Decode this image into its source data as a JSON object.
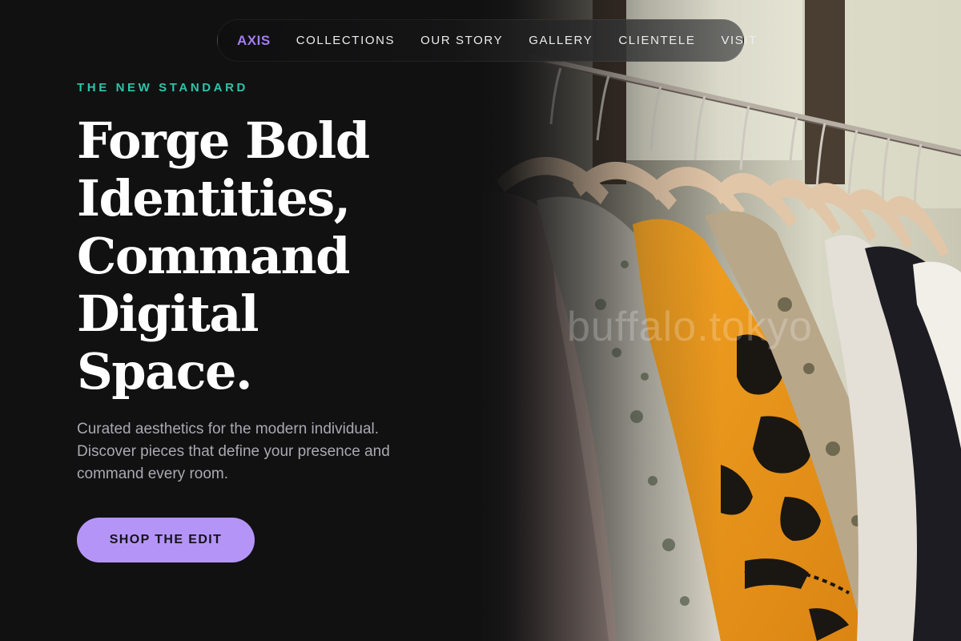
{
  "nav": {
    "brand": "AXIS",
    "links": [
      {
        "label": "COLLECTIONS"
      },
      {
        "label": "OUR STORY"
      },
      {
        "label": "GALLERY"
      },
      {
        "label": "CLIENTELE"
      },
      {
        "label": "VISIT"
      }
    ]
  },
  "hero": {
    "eyebrow": "THE NEW STANDARD",
    "headline_lines": [
      "Forge Bold",
      "Identities,",
      "Command",
      "Digital",
      "Space."
    ],
    "description": "Curated aesthetics for the modern individual. Discover pieces that define your presence and command every room.",
    "cta_label": "SHOP THE EDIT"
  },
  "image": {
    "watermark": "buffalo.tokyo"
  },
  "colors": {
    "background": "#111112",
    "accent_purple": "#a47cf0",
    "cta_purple": "#b495f7",
    "eyebrow_teal": "#2ec4a8",
    "headline": "#ffffff",
    "body_text": "#a9a9b0"
  }
}
